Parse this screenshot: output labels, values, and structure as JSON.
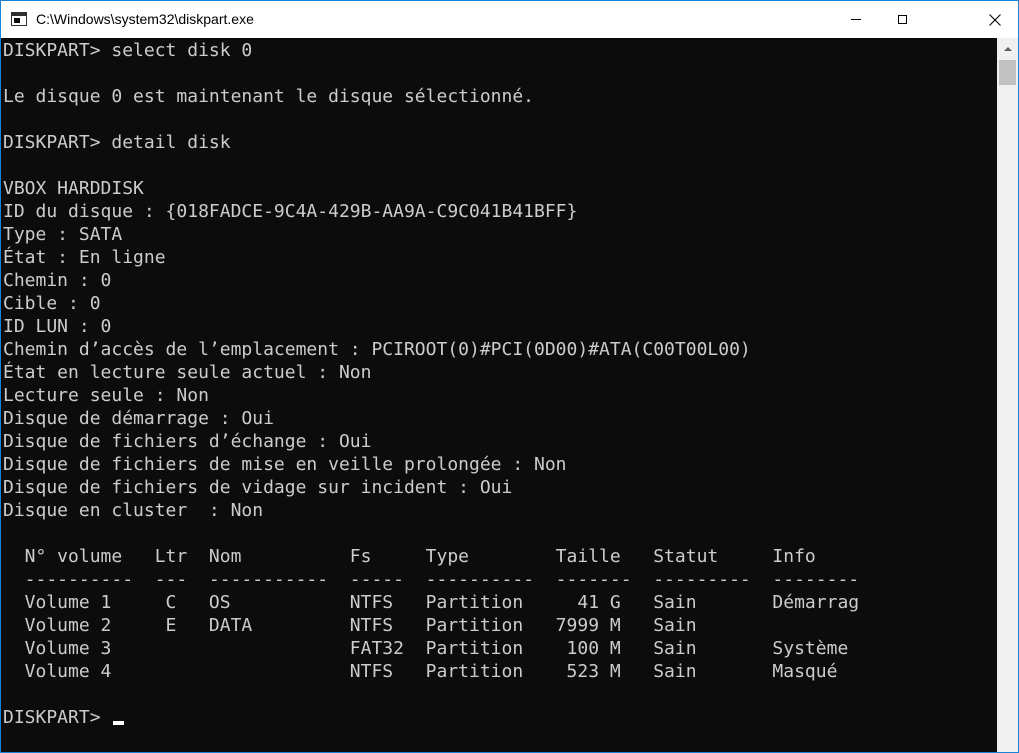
{
  "window": {
    "title": "C:\\Windows\\system32\\diskpart.exe",
    "accent_color": "#1883d7",
    "background_color": "#0c0c0c",
    "text_color": "#cccccc",
    "icons": {
      "app": "console-icon",
      "minimize": "minimize-icon",
      "maximize": "maximize-icon",
      "close": "close-icon",
      "scroll_up": "chevron-up-icon"
    }
  },
  "console": {
    "lines": [
      "DISKPART> select disk 0",
      "",
      "Le disque 0 est maintenant le disque sélectionné.",
      "",
      "DISKPART> detail disk",
      "",
      "VBOX HARDDISK",
      "ID du disque : {018FADCE-9C4A-429B-AA9A-C9C041B41BFF}",
      "Type : SATA",
      "État : En ligne",
      "Chemin : 0",
      "Cible : 0",
      "ID LUN : 0",
      "Chemin d’accès de l’emplacement : PCIROOT(0)#PCI(0D00)#ATA(C00T00L00)",
      "État en lecture seule actuel : Non",
      "Lecture seule : Non",
      "Disque de démarrage : Oui",
      "Disque de fichiers d’échange : Oui",
      "Disque de fichiers de mise en veille prolongée : Non",
      "Disque de fichiers de vidage sur incident : Oui",
      "Disque en cluster  : Non",
      "",
      "  N° volume   Ltr  Nom          Fs     Type        Taille   Statut     Info",
      "  ----------  ---  -----------  -----  ----------  -------  ---------  --------",
      "  Volume 1     C   OS           NTFS   Partition     41 G   Sain       Démarrag",
      "  Volume 2     E   DATA         NTFS   Partition   7999 M   Sain",
      "  Volume 3                      FAT32  Partition    100 M   Sain       Système",
      "  Volume 4                      NTFS   Partition    523 M   Sain       Masqué",
      "",
      "DISKPART> "
    ]
  }
}
